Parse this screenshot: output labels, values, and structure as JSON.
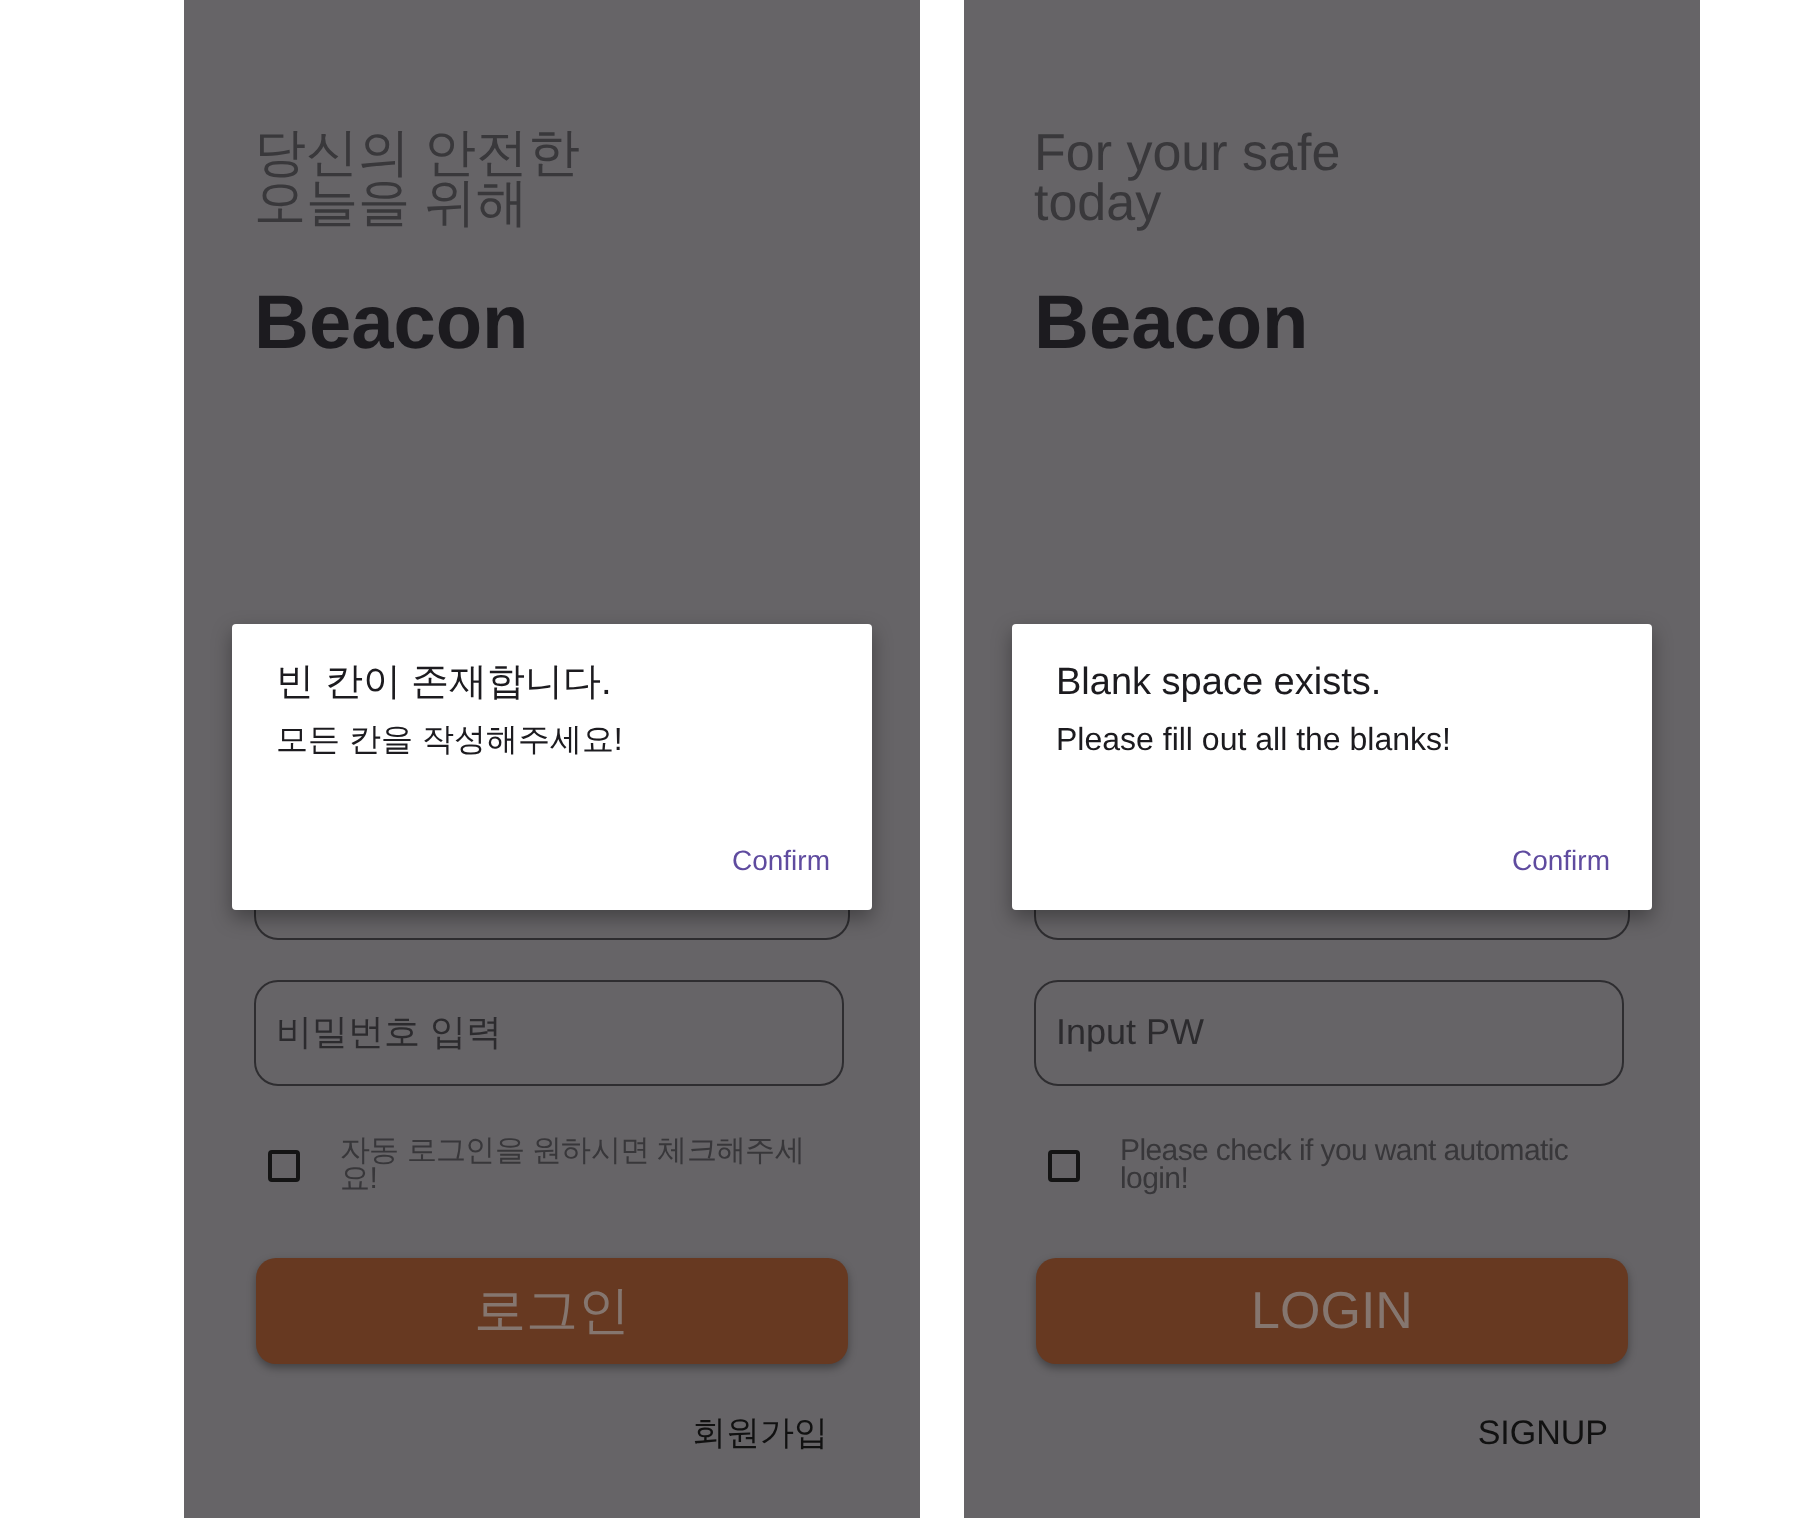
{
  "screens": [
    {
      "headline": [
        "당신의 안전한",
        "오늘을 위해"
      ],
      "app_name": "Beacon",
      "pw_field": {
        "placeholder": "비밀번호 입력"
      },
      "auto_login": {
        "label": "자동 로그인을 원하시면 체크해주세요!",
        "checked": false
      },
      "login_button": "로그인",
      "signup_link": "회원가입",
      "dialog": {
        "title": "빈 칸이 존재합니다.",
        "message": "모든 칸을 작성해주세요!",
        "confirm": "Confirm"
      }
    },
    {
      "headline": [
        "For your safe",
        "today"
      ],
      "app_name": "Beacon",
      "pw_field": {
        "placeholder": "Input PW"
      },
      "auto_login": {
        "label": "Please check if you want automatic login!",
        "checked": false
      },
      "login_button": "LOGIN",
      "signup_link": "SIGNUP",
      "dialog": {
        "title": "Blank space exists.",
        "message": "Please fill out all the blanks!",
        "confirm": "Confirm"
      }
    }
  ]
}
